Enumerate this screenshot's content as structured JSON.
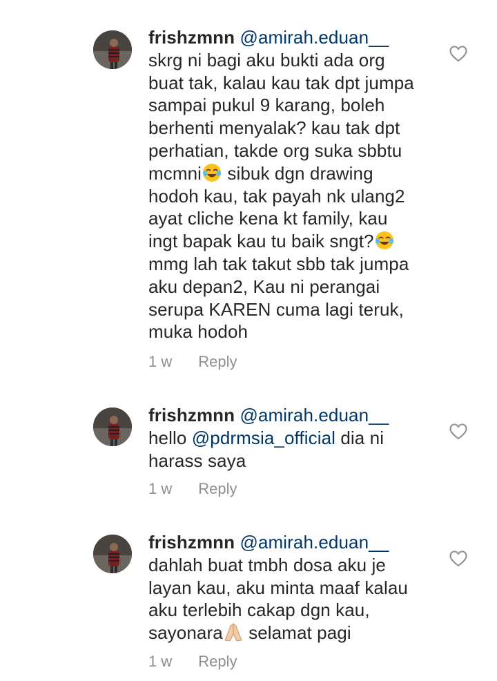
{
  "comments": [
    {
      "username": "frishzmnn",
      "mention": "@amirah.eduan__",
      "lines": [
        "skrg ni bagi aku bukti ada org",
        "buat tak, kalau kau tak dpt jumpa",
        "sampai pukul 9 karang, boleh",
        "berhenti menyalak? kau tak dpt",
        "perhatian, takde org suka sbbtu"
      ],
      "line6_a": "mcmni",
      "line6_b": " sibuk dgn drawing",
      "line7": "hodoh kau, tak payah nk ulang2",
      "line8": "ayat cliche kena kt family, kau",
      "line9_a": "ingt bapak kau tu baik sngt?",
      "lines_end": [
        "mmg lah tak takut sbb tak jumpa",
        "aku depan2, Kau ni perangai",
        "serupa KAREN cuma lagi teruk,",
        "muka hodoh"
      ],
      "time": "1 w",
      "reply": "Reply",
      "emoji_icon": "face-with-tears-of-joy-emoji"
    },
    {
      "username": "frishzmnn",
      "mention": "@amirah.eduan__",
      "hello": "hello ",
      "tag": "@pdrmsia_official",
      "after_tag": " dia ni",
      "line2": "harass saya",
      "time": "1 w",
      "reply": "Reply"
    },
    {
      "username": "frishzmnn",
      "mention": "@amirah.eduan__",
      "line1": "dahlah buat tmbh dosa aku je",
      "line2": "layan kau, aku minta maaf kalau",
      "line3": "aku terlebih cakap dgn kau,",
      "line4_a": "sayonara",
      "line4_b": " selamat pagi",
      "time": "1 w",
      "reply": "Reply",
      "emoji_icon": "folded-hands-emoji"
    }
  ],
  "colors": {
    "text": "#262626",
    "mention": "#00376b",
    "meta": "#8e8e8e"
  }
}
